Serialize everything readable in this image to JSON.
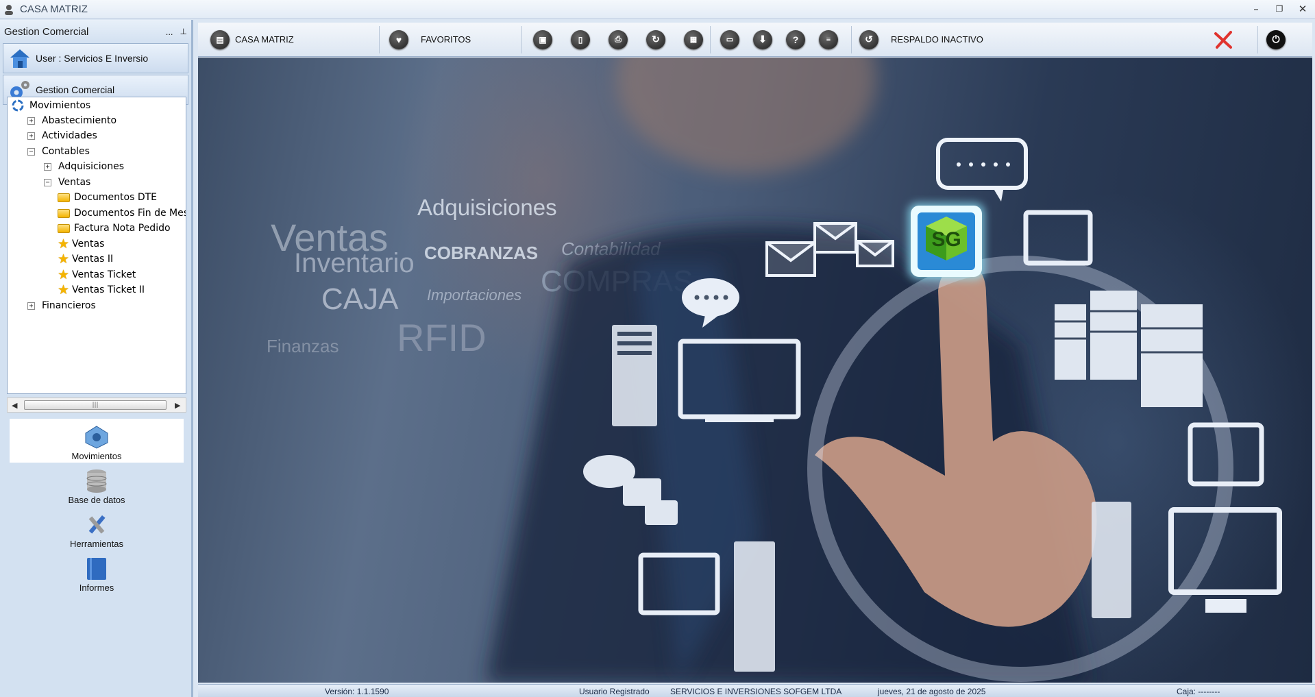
{
  "window": {
    "title": "CASA MATRIZ",
    "minimize": "–",
    "restore": "❐",
    "close": "✕"
  },
  "sidebar": {
    "header": "Gestion Comercial",
    "pin_dots": "...",
    "pin": "📌",
    "user_button": "User : Servicios E Inversio",
    "module_button": "Gestion Comercial",
    "tree": {
      "root": "Movimientos",
      "abastecimiento": "Abastecimiento",
      "actividades": "Actividades",
      "contables": "Contables",
      "adquisiciones": "Adquisiciones",
      "ventas_folder": "Ventas",
      "documentos_dte": "Documentos DTE",
      "documentos_fin_mes": "Documentos Fin de Mes",
      "factura_nota_pedido": "Factura Nota Pedido",
      "ventas": "Ventas",
      "ventas_ii": "Ventas II",
      "ventas_ticket": "Ventas Ticket",
      "ventas_ticket_ii": "Ventas Ticket II",
      "financieros": "Financieros"
    },
    "scroll_thumb": "|||",
    "modules": [
      "Movimientos",
      "Base de datos",
      "Herramientas",
      "Informes"
    ]
  },
  "toolbar": {
    "casa_matriz": "CASA MATRIZ",
    "favoritos": "FAVORITOS",
    "respaldo": "RESPALDO INACTIVO"
  },
  "background_words": {
    "adquisiciones": "Adquisiciones",
    "ventas": "Ventas",
    "cobranzas": "COBRANZAS",
    "contabilidad": "Contabilidad",
    "inventario": "Inventario",
    "compras": "COMPRAS",
    "caja": "CAJA",
    "importaciones": "Importaciones",
    "finanzas": "Finanzas",
    "rfid": "RFID",
    "logo": "SG"
  },
  "status": {
    "version": "Versión: 1.1.1590",
    "usuario_label": "Usuario Registrado",
    "empresa": "SERVICIOS E INVERSIONES SOFGEM LTDA",
    "fecha": "jueves, 21 de agosto de 2025",
    "caja": "Caja: --------"
  },
  "colors": {
    "accent": "#1e2b42",
    "panel": "#d3e1f1",
    "close_x": "#e0332e"
  }
}
